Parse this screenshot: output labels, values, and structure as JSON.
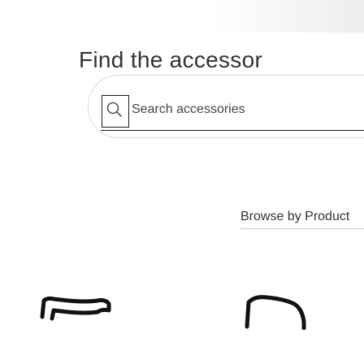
{
  "header": {
    "title": "Find the accessor"
  },
  "search": {
    "placeholder": "Search accessories",
    "icon": "search-icon"
  },
  "browse": {
    "label": "Browse by Product"
  },
  "colors": {
    "text": "#333333",
    "border": "#1a1a1a",
    "muted_border": "#dcdcdc"
  }
}
